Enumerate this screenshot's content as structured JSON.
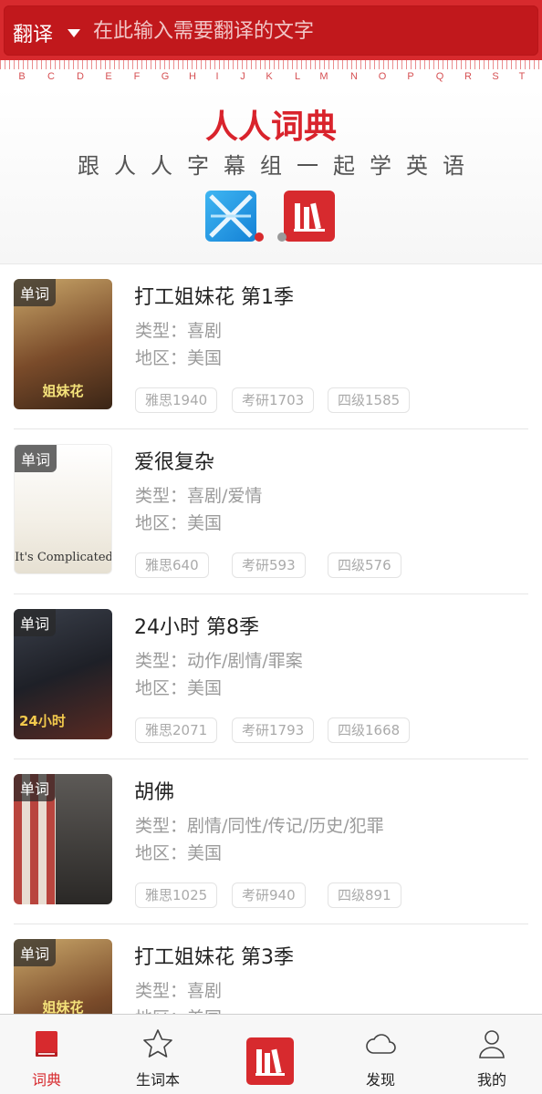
{
  "header": {
    "lang_label": "翻译",
    "search_placeholder": "在此输入需要翻译的文字",
    "ruler_letters": [
      "B",
      "C",
      "D",
      "E",
      "F",
      "G",
      "H",
      "I",
      "J",
      "K",
      "L",
      "M",
      "N",
      "O",
      "P",
      "Q",
      "R",
      "S",
      "T"
    ]
  },
  "banner": {
    "logo": "人人词典",
    "tagline": "跟人人字幕组一起学英语"
  },
  "items": [
    {
      "badge": "单词",
      "title": "打工姐妹花 第1季",
      "genre": "类型：喜剧",
      "region": "地区：美国",
      "tags": [
        "雅思1940",
        "考研1703",
        "四级1585"
      ],
      "poster_caption": "姐妹花"
    },
    {
      "badge": "单词",
      "title": "爱很复杂",
      "genre": "类型：喜剧/爱情",
      "region": "地区：美国",
      "tags": [
        "雅思640",
        "考研593",
        "四级576"
      ],
      "poster_caption": "It's Complicated"
    },
    {
      "badge": "单词",
      "title": "24小时 第8季",
      "genre": "类型：动作/剧情/罪案",
      "region": "地区：美国",
      "tags": [
        "雅思2071",
        "考研1793",
        "四级1668"
      ],
      "poster_caption": "24小时"
    },
    {
      "badge": "单词",
      "title": "胡佛",
      "genre": "类型：剧情/同性/传记/历史/犯罪",
      "region": "地区：美国",
      "tags": [
        "雅思1025",
        "考研940",
        "四级891"
      ],
      "poster_caption": ""
    },
    {
      "badge": "单词",
      "title": "打工姐妹花 第3季",
      "genre": "类型：喜剧",
      "region": "地区：美国",
      "tags": [],
      "poster_caption": "姐妹花"
    }
  ],
  "tabbar": {
    "tabs": [
      {
        "label": "词典",
        "icon": "dictionary-book-icon",
        "active": true
      },
      {
        "label": "生词本",
        "icon": "star-icon",
        "active": false
      },
      {
        "label": "",
        "icon": "renren-app-icon",
        "active": false
      },
      {
        "label": "发现",
        "icon": "cloud-icon",
        "active": false
      },
      {
        "label": "我的",
        "icon": "person-icon",
        "active": false
      }
    ]
  },
  "colors": {
    "brand_red": "#d72a2e",
    "text_gray": "#9b9b9b"
  }
}
